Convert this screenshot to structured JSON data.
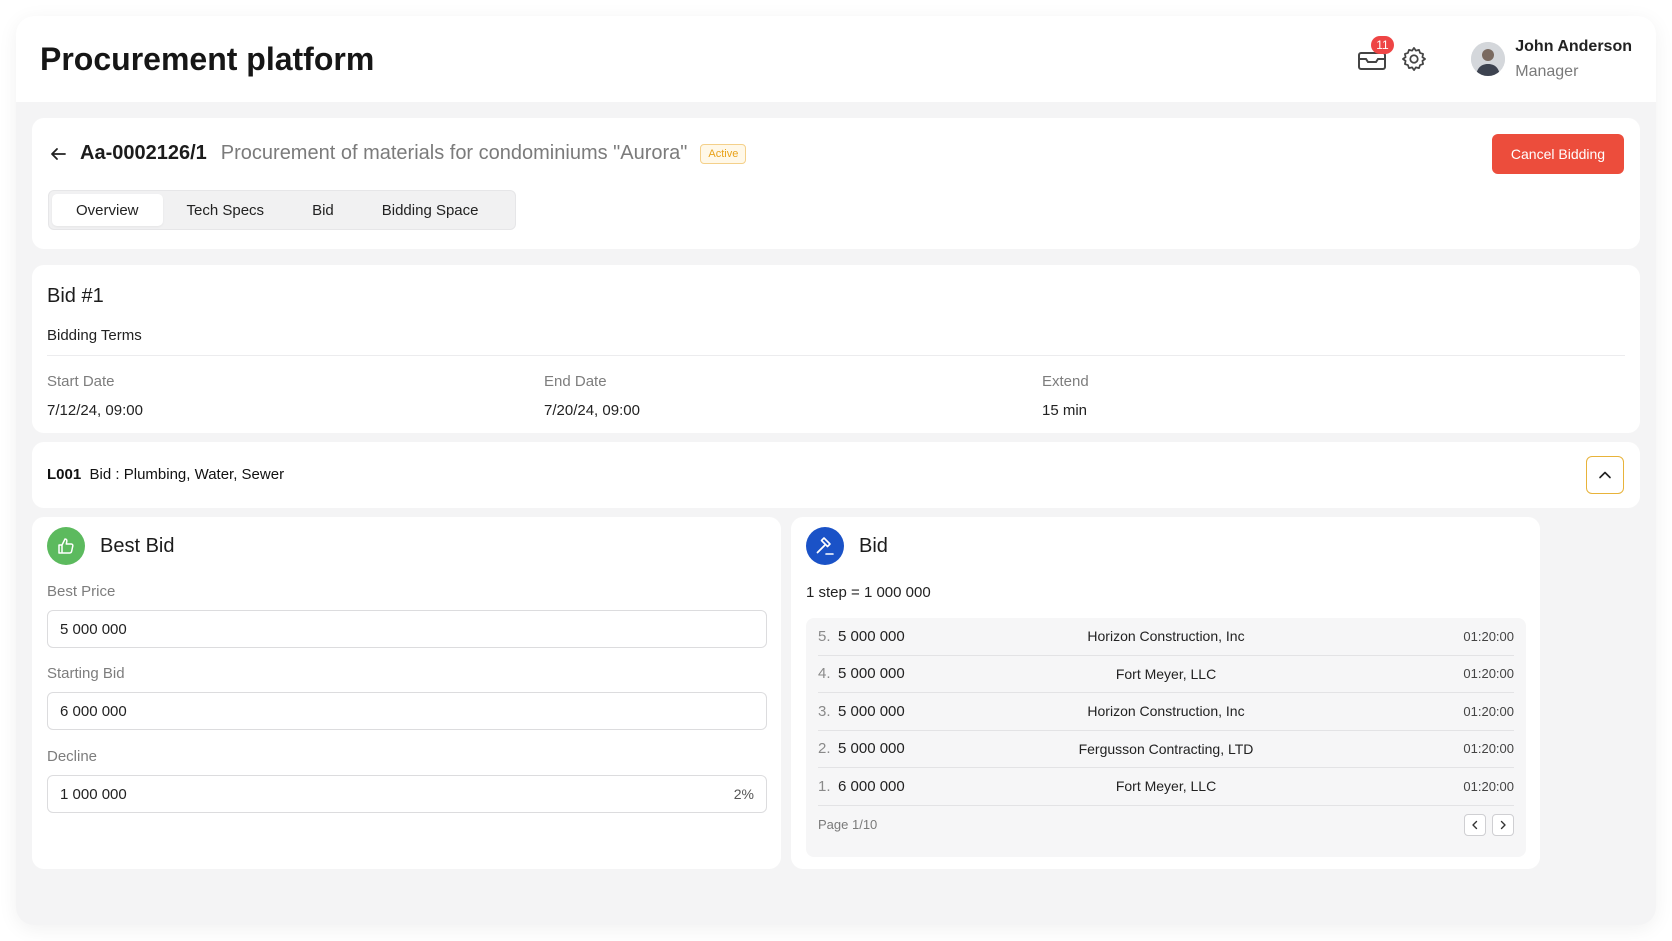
{
  "header": {
    "title": "Procurement platform",
    "notifications_count": "11",
    "user": {
      "name": "John Anderson",
      "role": "Manager"
    }
  },
  "procurement": {
    "id": "Aa-0002126/1",
    "name": "Procurement of materials for condominiums \"Aurora\"",
    "status": "Active",
    "cancel_label": "Cancel Bidding",
    "tabs": [
      {
        "label": "Overview",
        "active": true
      },
      {
        "label": "Tech Specs",
        "active": false
      },
      {
        "label": "Bid",
        "active": false
      },
      {
        "label": "Bidding Space",
        "active": false
      }
    ]
  },
  "bid": {
    "title": "Bid #1",
    "terms_label": "Bidding Terms",
    "start_date": {
      "label": "Start Date",
      "value": "7/12/24, 09:00"
    },
    "end_date": {
      "label": "End Date",
      "value": "7/20/24, 09:00"
    },
    "extend": {
      "label": "Extend",
      "value": "15 min"
    }
  },
  "lot": {
    "code": "L001",
    "label": "Bid : Plumbing, Water, Sewer"
  },
  "best_bid": {
    "title": "Best Bid",
    "best_price": {
      "label": "Best Price",
      "value": "5 000 000"
    },
    "starting_bid": {
      "label": "Starting Bid",
      "value": "6 000 000"
    },
    "decline": {
      "label": "Decline",
      "value": "1 000 000",
      "percent": "2%"
    }
  },
  "bid_list": {
    "title": "Bid",
    "step_text": "1 step = 1 000 000",
    "rows": [
      {
        "num": "5.",
        "amount": "5 000 000",
        "company": "Horizon Construction, Inc",
        "time": "01:20:00"
      },
      {
        "num": "4.",
        "amount": "5 000 000",
        "company": "Fort Meyer, LLC",
        "time": "01:20:00"
      },
      {
        "num": "3.",
        "amount": "5 000 000",
        "company": "Horizon Construction, Inc",
        "time": "01:20:00"
      },
      {
        "num": "2.",
        "amount": "5 000 000",
        "company": "Fergusson Contracting, LTD",
        "time": "01:20:00"
      },
      {
        "num": "1.",
        "amount": "6 000 000",
        "company": "Fort Meyer, LLC",
        "time": "01:20:00"
      }
    ],
    "page_label": "Page 1/10"
  },
  "colors": {
    "accent_red": "#ec4d3c",
    "active_yellow": "#e8a21a",
    "best_green": "#5cba5e",
    "bid_blue": "#1a52c7"
  },
  "icons": [
    "mail-icon",
    "gear-icon",
    "back-arrow-icon",
    "chevron-up-icon",
    "thumbs-up-icon",
    "gavel-icon",
    "chevron-left-icon",
    "chevron-right-icon"
  ]
}
